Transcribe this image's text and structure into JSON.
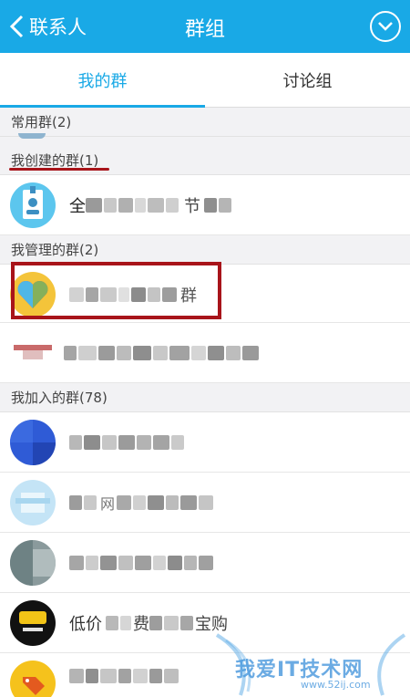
{
  "header": {
    "back_label": "联系人",
    "title": "群组",
    "menu_icon": "chevron-down-circle-icon"
  },
  "tabs": [
    {
      "label": "我的群",
      "active": true
    },
    {
      "label": "讨论组",
      "active": false
    }
  ],
  "sections": {
    "frequent": "常用群(2)",
    "created": "我创建的群(1)",
    "managed": "我管理的群(2)",
    "joined": "我加入的群(78)"
  },
  "groups": {
    "created_1": {
      "visible_text": "全 节",
      "avatar": "id-badge-avatar"
    },
    "managed_1": {
      "visible_text": "群",
      "avatar": "heart-logo-avatar"
    },
    "managed_2": {
      "visible_text": "",
      "avatar": "blurred-avatar"
    },
    "joined_1": {
      "visible_text": "",
      "avatar": "blurred-blue-avatar"
    },
    "joined_2": {
      "visible_text": "网",
      "avatar": "blurred-lightblue-avatar"
    },
    "joined_3": {
      "visible_text": "",
      "avatar": "blurred-gray-avatar"
    },
    "joined_4": {
      "visible_text": "低价 费 宝购",
      "avatar": "black-logo-avatar"
    },
    "joined_5": {
      "visible_text": "",
      "avatar": "tag-icon-avatar"
    }
  },
  "watermark": {
    "text": "我爱IT技术网",
    "url": "www.52ij.com"
  },
  "colors": {
    "primary": "#19a9e6",
    "annotation": "#a8141a"
  }
}
